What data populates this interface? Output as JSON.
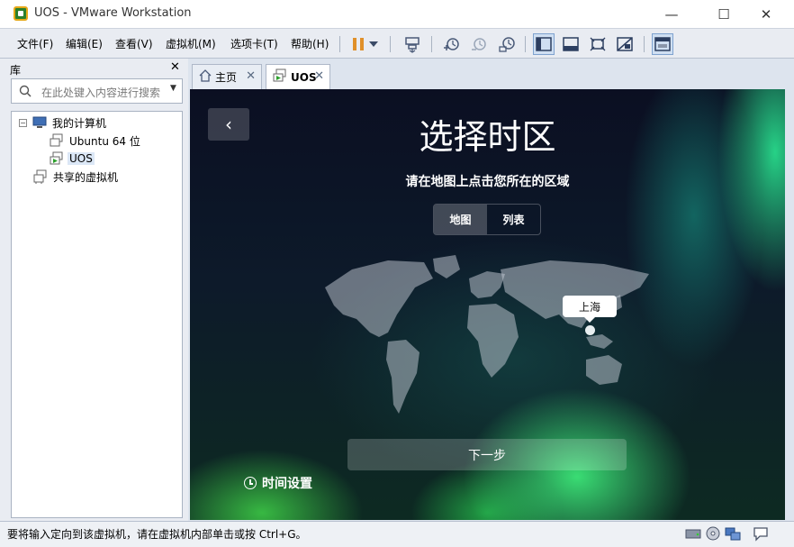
{
  "window": {
    "title": "UOS - VMware Workstation",
    "minimize_symbol": "—",
    "maximize_symbol": "☐",
    "close_symbol": "✕"
  },
  "menu": {
    "items": [
      "文件(F)",
      "编辑(E)",
      "查看(V)",
      "虚拟机(M)",
      "选项卡(T)",
      "帮助(H)"
    ]
  },
  "toolbar": {
    "icons": [
      "pause-icon",
      "dropdown-icon",
      "send-ctrl-alt-del-icon",
      "snapshot-take-icon",
      "snapshot-revert-icon",
      "snapshot-manager-icon",
      "view-library-icon",
      "view-thumbnail-icon",
      "fullscreen-icon",
      "unity-icon",
      "console-view-icon"
    ],
    "pause_color": "#e0902a",
    "active_color": "#cfdff2"
  },
  "library": {
    "title": "库",
    "close": "✕",
    "search_placeholder": "在此处键入内容进行搜索",
    "tree": {
      "root": "我的计算机",
      "expander": "−",
      "children": [
        "Ubuntu 64 位",
        "UOS"
      ],
      "shared": "共享的虚拟机"
    }
  },
  "tabs": [
    {
      "label": "主页",
      "close": "✕"
    },
    {
      "label": "UOS",
      "close": "✕"
    }
  ],
  "vm_screen": {
    "back": "‹",
    "title": "选择时区",
    "subtitle": "请在地图上点击您所在的区域",
    "segments": [
      "地图",
      "列表"
    ],
    "selected_segment": "地图",
    "pin_label": "上海",
    "next_button": "下一步",
    "time_settings": "时间设置"
  },
  "statusbar": {
    "text": "要将输入定向到该虚拟机，请在虚拟机内部单击或按 Ctrl+G。",
    "icons": [
      "hard-disk-icon",
      "cd-rom-icon",
      "network-icon",
      "message-icon"
    ]
  }
}
